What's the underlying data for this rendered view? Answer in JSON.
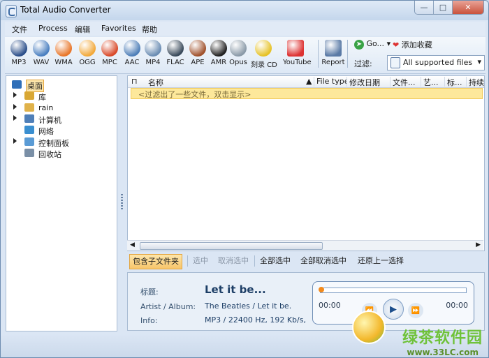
{
  "window": {
    "title": "Total Audio Converter"
  },
  "menu": [
    "文件",
    "Process",
    "编辑",
    "Favorites",
    "帮助"
  ],
  "toolbar": {
    "formats": [
      {
        "label": "MP3",
        "color": "#2b4f8a"
      },
      {
        "label": "WAV",
        "color": "#4a7fc0"
      },
      {
        "label": "WMA",
        "color": "#e8762a"
      },
      {
        "label": "OGG",
        "color": "#f2a93b"
      },
      {
        "label": "MPC",
        "color": "#d94a2a"
      },
      {
        "label": "AAC",
        "color": "#4f7fb8"
      },
      {
        "label": "MP4",
        "color": "#6b8db3"
      },
      {
        "label": "FLAC",
        "color": "#3a4b5c"
      },
      {
        "label": "APE",
        "color": "#a0522d"
      },
      {
        "label": "AMR",
        "color": "#222222"
      },
      {
        "label": "Opus",
        "color": "#8a9aa8"
      },
      {
        "label": "刻录 CD",
        "color": "#e6c227"
      },
      {
        "label": "YouTube",
        "color": "#d33"
      },
      {
        "label": "Report",
        "color": "#5a7aa6"
      }
    ],
    "go_label": "Go...",
    "favorite_label": "添加收藏",
    "filter_label": "过滤:",
    "filter_value": "All supported files"
  },
  "tree": [
    {
      "label": "桌面",
      "selected": true,
      "arrow": false
    },
    {
      "label": "库",
      "arrow": true
    },
    {
      "label": "rain",
      "arrow": true
    },
    {
      "label": "计算机",
      "arrow": true
    },
    {
      "label": "网络",
      "arrow": false
    },
    {
      "label": "控制面板",
      "arrow": true
    },
    {
      "label": "回收站",
      "arrow": false
    }
  ],
  "list": {
    "columns": [
      "名称",
      "File type",
      "修改日期",
      "文件...",
      "艺...",
      "标...",
      "持续..."
    ],
    "filter_message": "<过滤出了一些文件，双击显示>"
  },
  "selection": {
    "include_subfolders": "包含子文件夹",
    "select": "选中",
    "deselect": "取消选中",
    "select_all": "全部选中",
    "deselect_all": "全部取消选中",
    "restore": "还原上一选择"
  },
  "player": {
    "title_label": "标题:",
    "title_value": "Let it be...",
    "artist_label": "Artist / Album:",
    "artist_value": "The Beatles / Let it be.",
    "info_label": "Info:",
    "info_value": "MP3 / 22400 Hz, 192 Kb/s,",
    "time_elapsed": "00:00",
    "time_total": "00:00",
    "progress": 0
  },
  "watermark": {
    "text": "绿茶软件园",
    "url": "www.33LC.com"
  }
}
